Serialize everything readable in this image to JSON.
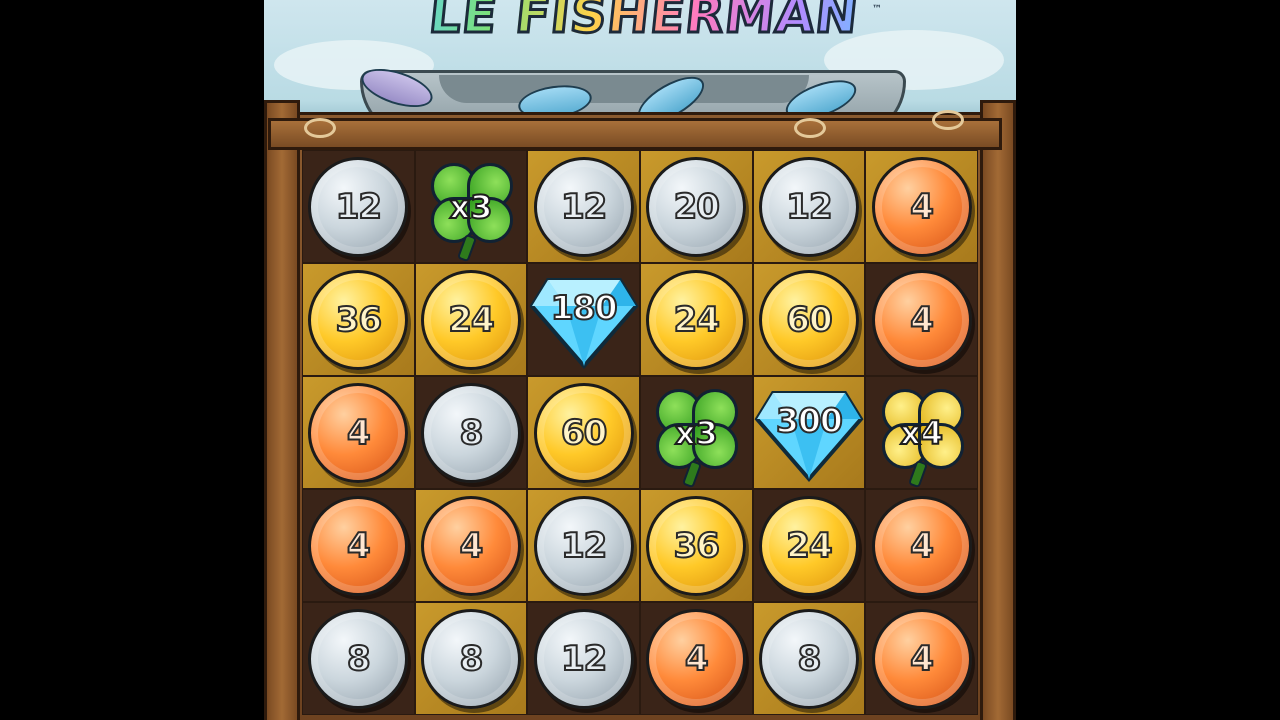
{
  "game": {
    "title": "LE FISHERMAN",
    "trademark": "™"
  },
  "grid": {
    "rows": [
      [
        {
          "type": "coin",
          "tier": "silver",
          "value": "12",
          "bg": "dark"
        },
        {
          "type": "clover",
          "tier": "green",
          "value": "x3",
          "bg": "dark"
        },
        {
          "type": "coin",
          "tier": "silver",
          "value": "12",
          "bg": "gold"
        },
        {
          "type": "coin",
          "tier": "silver",
          "value": "20",
          "bg": "gold"
        },
        {
          "type": "coin",
          "tier": "silver",
          "value": "12",
          "bg": "gold"
        },
        {
          "type": "coin",
          "tier": "copper",
          "value": "4",
          "bg": "gold"
        }
      ],
      [
        {
          "type": "coin",
          "tier": "gold",
          "value": "36",
          "bg": "gold"
        },
        {
          "type": "coin",
          "tier": "gold",
          "value": "24",
          "bg": "gold"
        },
        {
          "type": "gem",
          "tier": "diamond",
          "value": "180",
          "bg": "dark"
        },
        {
          "type": "coin",
          "tier": "gold",
          "value": "24",
          "bg": "gold"
        },
        {
          "type": "coin",
          "tier": "gold",
          "value": "60",
          "bg": "gold"
        },
        {
          "type": "coin",
          "tier": "copper",
          "value": "4",
          "bg": "dark"
        }
      ],
      [
        {
          "type": "coin",
          "tier": "copper",
          "value": "4",
          "bg": "gold"
        },
        {
          "type": "coin",
          "tier": "silver",
          "value": "8",
          "bg": "dark"
        },
        {
          "type": "coin",
          "tier": "gold",
          "value": "60",
          "bg": "gold"
        },
        {
          "type": "clover",
          "tier": "green",
          "value": "x3",
          "bg": "dark"
        },
        {
          "type": "gem",
          "tier": "diamond",
          "value": "300",
          "bg": "gold"
        },
        {
          "type": "clover",
          "tier": "goldc",
          "value": "x4",
          "bg": "dark"
        }
      ],
      [
        {
          "type": "coin",
          "tier": "copper",
          "value": "4",
          "bg": "dark"
        },
        {
          "type": "coin",
          "tier": "copper",
          "value": "4",
          "bg": "gold"
        },
        {
          "type": "coin",
          "tier": "silver",
          "value": "12",
          "bg": "gold"
        },
        {
          "type": "coin",
          "tier": "gold",
          "value": "36",
          "bg": "gold"
        },
        {
          "type": "coin",
          "tier": "gold",
          "value": "24",
          "bg": "dark"
        },
        {
          "type": "coin",
          "tier": "copper",
          "value": "4",
          "bg": "dark"
        }
      ],
      [
        {
          "type": "coin",
          "tier": "silver",
          "value": "8",
          "bg": "dark"
        },
        {
          "type": "coin",
          "tier": "silver",
          "value": "8",
          "bg": "gold"
        },
        {
          "type": "coin",
          "tier": "silver",
          "value": "12",
          "bg": "dark"
        },
        {
          "type": "coin",
          "tier": "copper",
          "value": "4",
          "bg": "dark"
        },
        {
          "type": "coin",
          "tier": "silver",
          "value": "8",
          "bg": "gold"
        },
        {
          "type": "coin",
          "tier": "copper",
          "value": "4",
          "bg": "dark"
        }
      ]
    ]
  }
}
